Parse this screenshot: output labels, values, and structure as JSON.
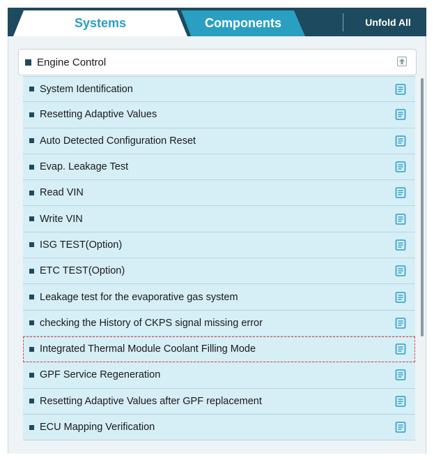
{
  "tabs": {
    "systems": "Systems",
    "components": "Components",
    "unfold_all": "Unfold All"
  },
  "group": {
    "title": "Engine Control"
  },
  "items": [
    {
      "label": "System Identification"
    },
    {
      "label": "Resetting Adaptive Values"
    },
    {
      "label": "Auto Detected Configuration Reset"
    },
    {
      "label": "Evap. Leakage Test"
    },
    {
      "label": "Read VIN"
    },
    {
      "label": "Write VIN"
    },
    {
      "label": "ISG TEST(Option)"
    },
    {
      "label": "ETC TEST(Option)"
    },
    {
      "label": "Leakage test for the evaporative gas system"
    },
    {
      "label": "checking the History of  CKPS signal missing error"
    },
    {
      "label": "Integrated Thermal Module Coolant Filling Mode",
      "highlighted": true
    },
    {
      "label": "GPF Service Regeneration"
    },
    {
      "label": "Resetting Adaptive Values after GPF replacement"
    },
    {
      "label": "ECU Mapping Verification"
    }
  ],
  "colors": {
    "header_bg": "#1d4a5e",
    "accent": "#2a9fc2",
    "row_bg": "#d6eef6",
    "highlight_border": "#e04040"
  }
}
